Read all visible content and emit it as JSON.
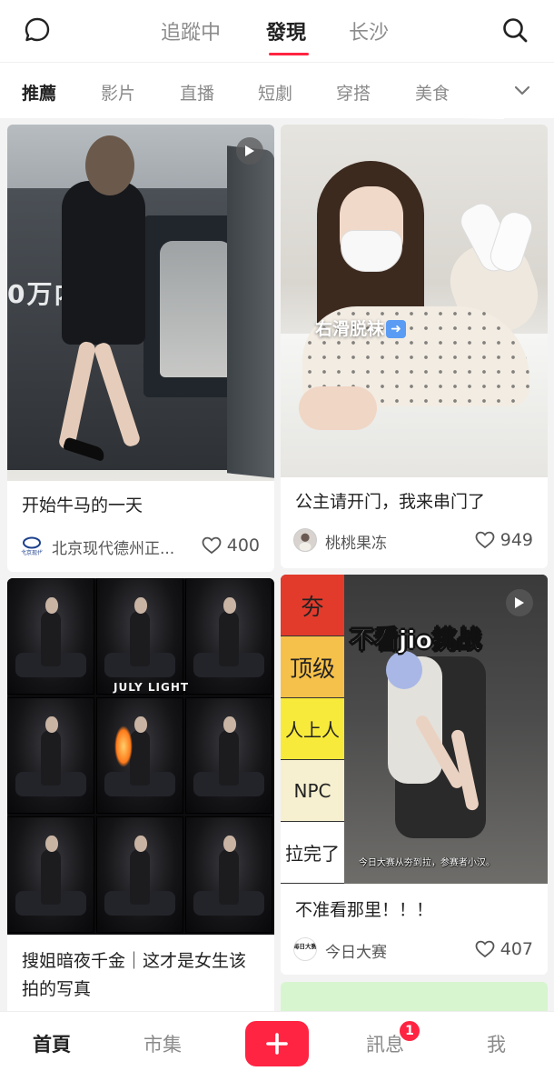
{
  "header": {
    "tabs": [
      "追蹤中",
      "發現",
      "长沙"
    ],
    "active_tab": "發現",
    "icons": {
      "left": "chat-bubble-icon",
      "right": "search-icon"
    }
  },
  "categories": {
    "items": [
      "推薦",
      "影片",
      "直播",
      "短劇",
      "穿搭",
      "美食"
    ],
    "active": "推薦",
    "more_icon": "chevron-down-icon"
  },
  "feed": [
    {
      "title": "开始牛马的一天",
      "image_text": "0万内含",
      "author": "北京现代德州正...",
      "avatar_text": "北京现代",
      "likes": "400",
      "has_video": true
    },
    {
      "title": "公主请开门，我来串门了",
      "image_text": "右滑脱袜",
      "author": "桃桃果冻",
      "likes": "949",
      "has_video": false
    },
    {
      "title": "搜姐暗夜千金｜这才是女生该拍的写真",
      "image_text": "JULY LIGHT",
      "has_video": false
    },
    {
      "title": "不准看那里！！！",
      "image_headline": "不看jio挑战",
      "image_caption": "今日大赛从夯到拉，参赛者小汉。",
      "tiers": [
        {
          "label": "夯",
          "color": "#e23b2c"
        },
        {
          "label": "顶级",
          "color": "#f5c14a"
        },
        {
          "label": "人上人",
          "color": "#f7ea3a"
        },
        {
          "label": "NPC",
          "color": "#f6f0d0"
        },
        {
          "label": "拉完了",
          "color": "#ffffff"
        }
      ],
      "author": "今日大赛",
      "avatar_text": "每日大赛",
      "likes": "407",
      "has_video": true
    }
  ],
  "bottom_nav": {
    "items": [
      "首頁",
      "市集",
      "訊息",
      "我"
    ],
    "active": "首頁",
    "post_icon": "plus-icon",
    "message_badge": "1"
  },
  "colors": {
    "accent": "#ff2442",
    "background": "#f3f3f3"
  }
}
